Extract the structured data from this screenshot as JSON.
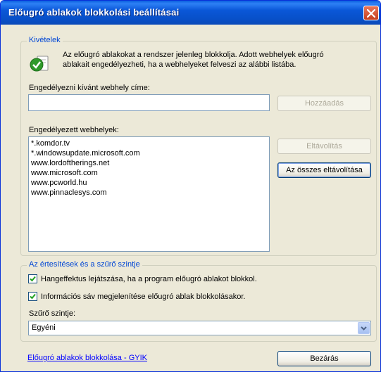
{
  "window": {
    "title": "Előugró ablakok blokkolási beállításai"
  },
  "exceptions": {
    "legend": "Kivételek",
    "info_line1": "Az előugró ablakokat a rendszer jelenleg blokkolja. Adott webhelyek előugró",
    "info_line2": "ablakait engedélyezheti, ha a webhelyeket felveszi az alábbi listába.",
    "address_label": "Engedélyezni kívánt webhely címe:",
    "address_value": "",
    "add_button": "Hozzáadás",
    "allowed_label": "Engedélyezett webhelyek:",
    "allowed_sites": [
      "*.komdor.tv",
      "*.windowsupdate.microsoft.com",
      "www.lordoftherings.net",
      "www.microsoft.com",
      "www.pcworld.hu",
      "www.pinnaclesys.com"
    ],
    "remove_button": "Eltávolítás",
    "remove_all_button": "Az összes eltávolítása"
  },
  "notifications": {
    "legend": "Az értesítések és a szűrő szintje",
    "sound_checkbox": "Hangeffektus lejátszása, ha a program előugró ablakot blokkol.",
    "sound_checked": true,
    "infobar_checkbox": "Információs sáv megjelenítése előugró ablak blokkolásakor.",
    "infobar_checked": true,
    "filter_label": "Szűrő szintje:",
    "filter_value": "Egyéni"
  },
  "footer": {
    "help_link": "Előugró ablakok blokkolása - GYIK",
    "close_button": "Bezárás"
  },
  "icons": {
    "title_close": "close-icon",
    "info": "shield-check-icon",
    "dropdown": "chevron-down-icon"
  },
  "colors": {
    "titlebar": "#0a57d8",
    "window_bg": "#ece9d8",
    "legend_text": "#0046d5",
    "link": "#0000ff",
    "close_button": "#c5401f"
  }
}
